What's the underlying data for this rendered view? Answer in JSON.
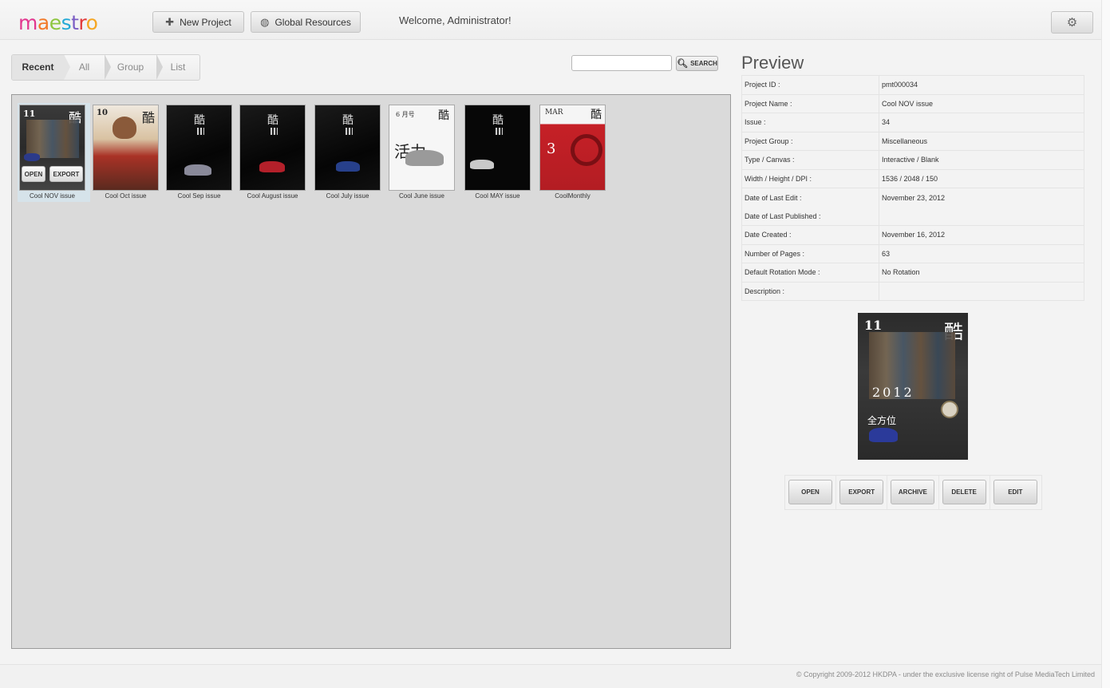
{
  "header": {
    "logo_text": "maestro",
    "new_project_label": "New Project",
    "global_resources_label": "Global Resources",
    "welcome_text": "Welcome, Administrator!",
    "icons": {
      "new_project": "plus-icon",
      "global_resources": "globe-icon",
      "settings": "gear-icon"
    }
  },
  "tabs": [
    {
      "label": "Recent",
      "active": true
    },
    {
      "label": "All",
      "active": false
    },
    {
      "label": "Group",
      "active": false
    },
    {
      "label": "List",
      "active": false
    }
  ],
  "search": {
    "placeholder": "",
    "value": "",
    "button_label": "SEARCH"
  },
  "projects": [
    {
      "label": "Cool NOV issue",
      "selected": true,
      "open_label": "OPEN",
      "export_label": "EXPORT"
    },
    {
      "label": "Cool Oct issue"
    },
    {
      "label": "Cool Sep issue"
    },
    {
      "label": "Cool August issue"
    },
    {
      "label": "Cool July issue"
    },
    {
      "label": "Cool June issue"
    },
    {
      "label": "Cool MAY issue"
    },
    {
      "label": "CoolMonthly"
    }
  ],
  "preview": {
    "title": "Preview",
    "rows": [
      {
        "key": "Project ID :",
        "value": "pmt000034"
      },
      {
        "key": "Project Name :",
        "value": "Cool NOV issue"
      },
      {
        "key": "Issue :",
        "value": "34"
      },
      {
        "key": "Project Group :",
        "value": "Miscellaneous"
      },
      {
        "key": "Type / Canvas :",
        "value": "Interactive / Blank"
      },
      {
        "key": "Width / Height / DPI :",
        "value": "1536 / 2048 / 150"
      },
      {
        "key": "Date of Last Edit :",
        "value": "November 23, 2012"
      },
      {
        "key": "Date of Last Published :",
        "value": ""
      },
      {
        "key": "Date Created :",
        "value": "November 16, 2012"
      },
      {
        "key": "Number of Pages :",
        "value": "63"
      },
      {
        "key": "Default Rotation Mode :",
        "value": "No Rotation"
      },
      {
        "key": "Description :",
        "value": ""
      }
    ],
    "actions": [
      "OPEN",
      "EXPORT",
      "ARCHIVE",
      "DELETE",
      "EDIT"
    ]
  },
  "footer": {
    "copyright": "© Copyright 2009-2012 HKDPA - under the exclusive license right of Pulse MediaTech Limited"
  }
}
